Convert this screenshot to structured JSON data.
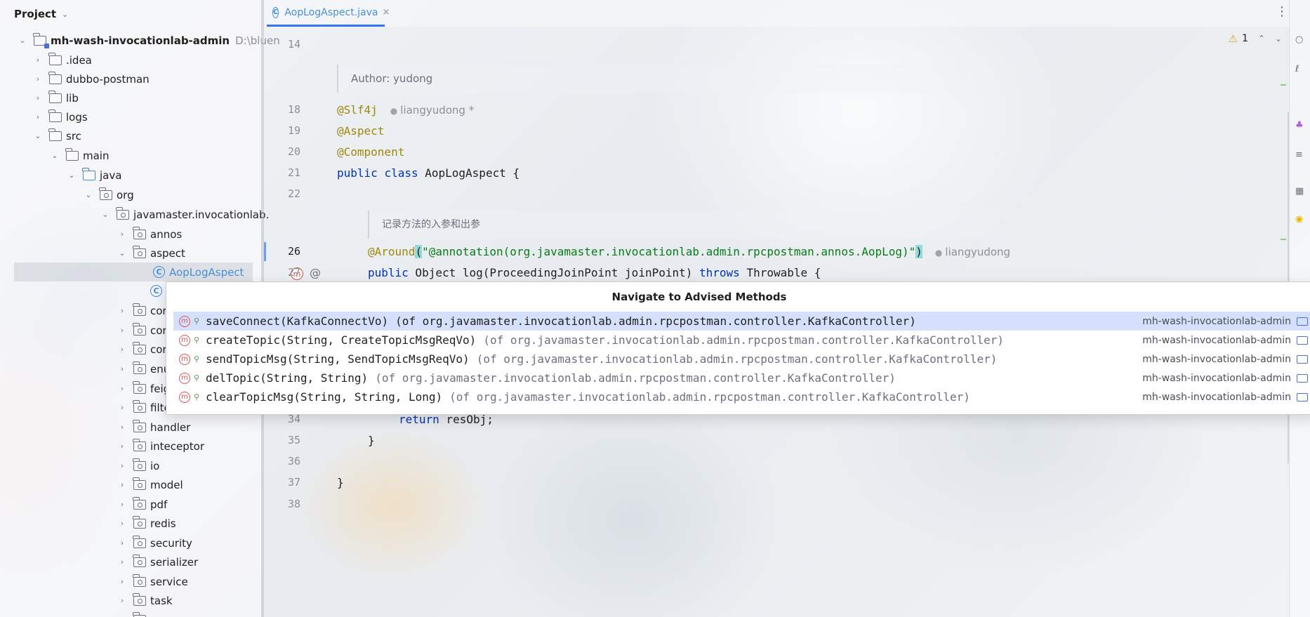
{
  "project_panel": {
    "title": "Project",
    "tree": [
      {
        "label": "mh-wash-invocationlab-admin",
        "extra": "D:\\bluen",
        "kind": "module",
        "expanded": true
      },
      {
        "label": ".idea",
        "kind": "folder"
      },
      {
        "label": "dubbo-postman",
        "kind": "folder"
      },
      {
        "label": "lib",
        "kind": "folder"
      },
      {
        "label": "logs",
        "kind": "folder"
      },
      {
        "label": "src",
        "kind": "folder",
        "expanded": true
      },
      {
        "label": "main",
        "kind": "folder",
        "expanded": true
      },
      {
        "label": "java",
        "kind": "folder",
        "expanded": true
      },
      {
        "label": "org",
        "kind": "package",
        "expanded": true
      },
      {
        "label": "javamaster.invocationlab.",
        "kind": "package",
        "expanded": true
      },
      {
        "label": "annos",
        "kind": "package"
      },
      {
        "label": "aspect",
        "kind": "package",
        "expanded": true
      },
      {
        "label": "AopLogAspect",
        "kind": "class",
        "selected": true
      },
      {
        "label": "",
        "kind": "class"
      },
      {
        "label": "cor",
        "kind": "package"
      },
      {
        "label": "cor",
        "kind": "package"
      },
      {
        "label": "cor",
        "kind": "package"
      },
      {
        "label": "enu",
        "kind": "package"
      },
      {
        "label": "feig",
        "kind": "package"
      },
      {
        "label": "filte",
        "kind": "package"
      },
      {
        "label": "handler",
        "kind": "package"
      },
      {
        "label": "inteceptor",
        "kind": "package"
      },
      {
        "label": "io",
        "kind": "package"
      },
      {
        "label": "model",
        "kind": "package"
      },
      {
        "label": "pdf",
        "kind": "package"
      },
      {
        "label": "redis",
        "kind": "package"
      },
      {
        "label": "security",
        "kind": "package"
      },
      {
        "label": "serializer",
        "kind": "package"
      },
      {
        "label": "service",
        "kind": "package"
      },
      {
        "label": "task",
        "kind": "package"
      },
      {
        "label": "",
        "kind": "package"
      }
    ]
  },
  "editor": {
    "tab": {
      "label": "AopLogAspect.java",
      "close": "×"
    },
    "inspection_count": "1",
    "author_doc": "Author: yudong",
    "method_doc": "记录方法的入参和出参",
    "lines": {
      "n14": "14",
      "n18": "18",
      "n19": "19",
      "n20": "20",
      "n21": "21",
      "n22": "22",
      "n26": "26",
      "n27": "27",
      "n34": "34",
      "n35": "35",
      "n36": "36",
      "n37": "37",
      "n38": "38"
    },
    "code": {
      "slf4j": "@Slf4j",
      "slf4j_hint": "liangyudong *",
      "aspect": "@Aspect",
      "component": "@Component",
      "class_kw1": "public",
      "class_kw2": "class",
      "class_rest": " AopLogAspect {",
      "around": "@Around",
      "around_open": "(",
      "around_str": "\"@annotation(org.javamaster.invocationlab.admin.rpcpostman.annos.AopLog)\"",
      "around_close": ")",
      "around_hint": "liangyudong",
      "log_kw1": "public",
      "log_mid": " Object log(ProceedingJoinPoint joinPoint) ",
      "log_kw2": "throws",
      "log_end": " Throwable {",
      "return_kw": "return",
      "return_rest": " resObj;",
      "close_inner": "}",
      "close_outer": "}"
    }
  },
  "popup": {
    "title": "Navigate to Advised Methods",
    "items": [
      {
        "signature": "saveConnect(KafkaConnectVo)",
        "location": "(of org.javamaster.invocationlab.admin.rpcpostman.controller.KafkaController)",
        "module": "mh-wash-invocationlab-admin",
        "selected": true
      },
      {
        "signature": "createTopic(String, CreateTopicMsgReqVo)",
        "location": "(of org.javamaster.invocationlab.admin.rpcpostman.controller.KafkaController)",
        "module": "mh-wash-invocationlab-admin"
      },
      {
        "signature": "sendTopicMsg(String, SendTopicMsgReqVo)",
        "location": "(of org.javamaster.invocationlab.admin.rpcpostman.controller.KafkaController)",
        "module": "mh-wash-invocationlab-admin"
      },
      {
        "signature": "delTopic(String, String)",
        "location": "(of org.javamaster.invocationlab.admin.rpcpostman.controller.KafkaController)",
        "module": "mh-wash-invocationlab-admin"
      },
      {
        "signature": "clearTopicMsg(String, String, Long)",
        "location": "(of org.javamaster.invocationlab.admin.rpcpostman.controller.KafkaController)",
        "module": "mh-wash-invocationlab-admin"
      }
    ]
  },
  "colors": {
    "accent": "#3574f0",
    "keyword": "#0033b3",
    "annotation": "#9e880d",
    "string": "#067d17",
    "selection": "#d5e1fc"
  }
}
